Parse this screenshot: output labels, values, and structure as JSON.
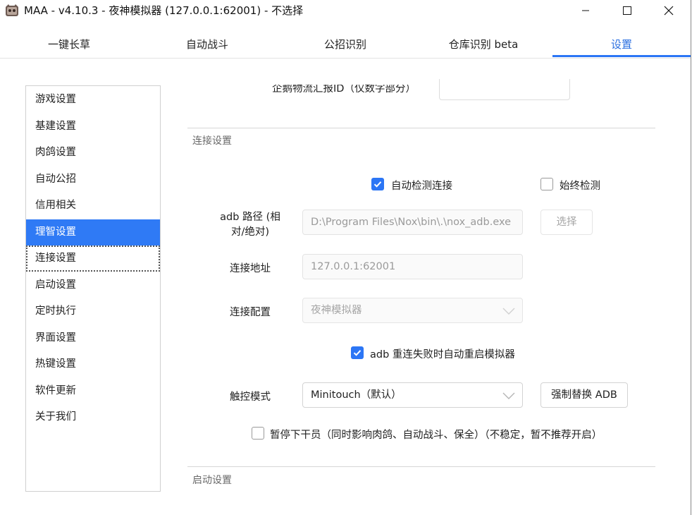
{
  "window": {
    "title": "MAA - v4.10.3 - 夜神模拟器 (127.0.0.1:62001) - 不选择",
    "minimize_icon": "minimize-icon",
    "maximize_icon": "maximize-icon",
    "close_icon": "close-icon"
  },
  "tabs": [
    {
      "label": "一键长草",
      "active": false
    },
    {
      "label": "自动战斗",
      "active": false
    },
    {
      "label": "公招识别",
      "active": false
    },
    {
      "label": "仓库识别 beta",
      "active": false
    },
    {
      "label": "设置",
      "active": true
    }
  ],
  "sidebar": {
    "items": [
      {
        "label": "游戏设置"
      },
      {
        "label": "基建设置"
      },
      {
        "label": "肉鸽设置"
      },
      {
        "label": "自动公招"
      },
      {
        "label": "信用相关"
      },
      {
        "label": "理智设置",
        "selected": true
      },
      {
        "label": "连接设置",
        "focused": true
      },
      {
        "label": "启动设置"
      },
      {
        "label": "定时执行"
      },
      {
        "label": "界面设置"
      },
      {
        "label": "热键设置"
      },
      {
        "label": "软件更新"
      },
      {
        "label": "关于我们"
      }
    ]
  },
  "main": {
    "prev_field_label": "企鹅物流汇报ID（仅数字部分）",
    "prev_field_value": "",
    "connection": {
      "section_title": "连接设置",
      "auto_detect": {
        "label": "自动检测连接",
        "checked": true
      },
      "always_detect": {
        "label": "始终检测",
        "checked": false
      },
      "adb_path": {
        "label_line1": "adb 路径 (相",
        "label_line2": "对/绝对)",
        "value": "D:\\Program Files\\Nox\\bin\\.\\nox_adb.exe"
      },
      "select_button": "选择",
      "address": {
        "label": "连接地址",
        "value": "127.0.0.1:62001"
      },
      "config": {
        "label": "连接配置",
        "value": "夜神模拟器"
      },
      "restart_emulator": {
        "label": "adb 重连失败时自动重启模拟器",
        "checked": true
      },
      "touch_mode": {
        "label": "触控模式",
        "value": "Minitouch（默认）"
      },
      "force_replace_adb": "强制替换 ADB",
      "pause_operator": {
        "label": "暂停下干员（同时影响肉鸽、自动战斗、保全）（不稳定，暂不推荐开启）",
        "checked": false
      }
    },
    "startup": {
      "section_title": "启动设置"
    }
  },
  "colors": {
    "accent": "#2c76f5",
    "active_tab_text": "#2b6fe0",
    "divider": "#d6d6d6",
    "disabled_text": "#9a9a9a"
  }
}
